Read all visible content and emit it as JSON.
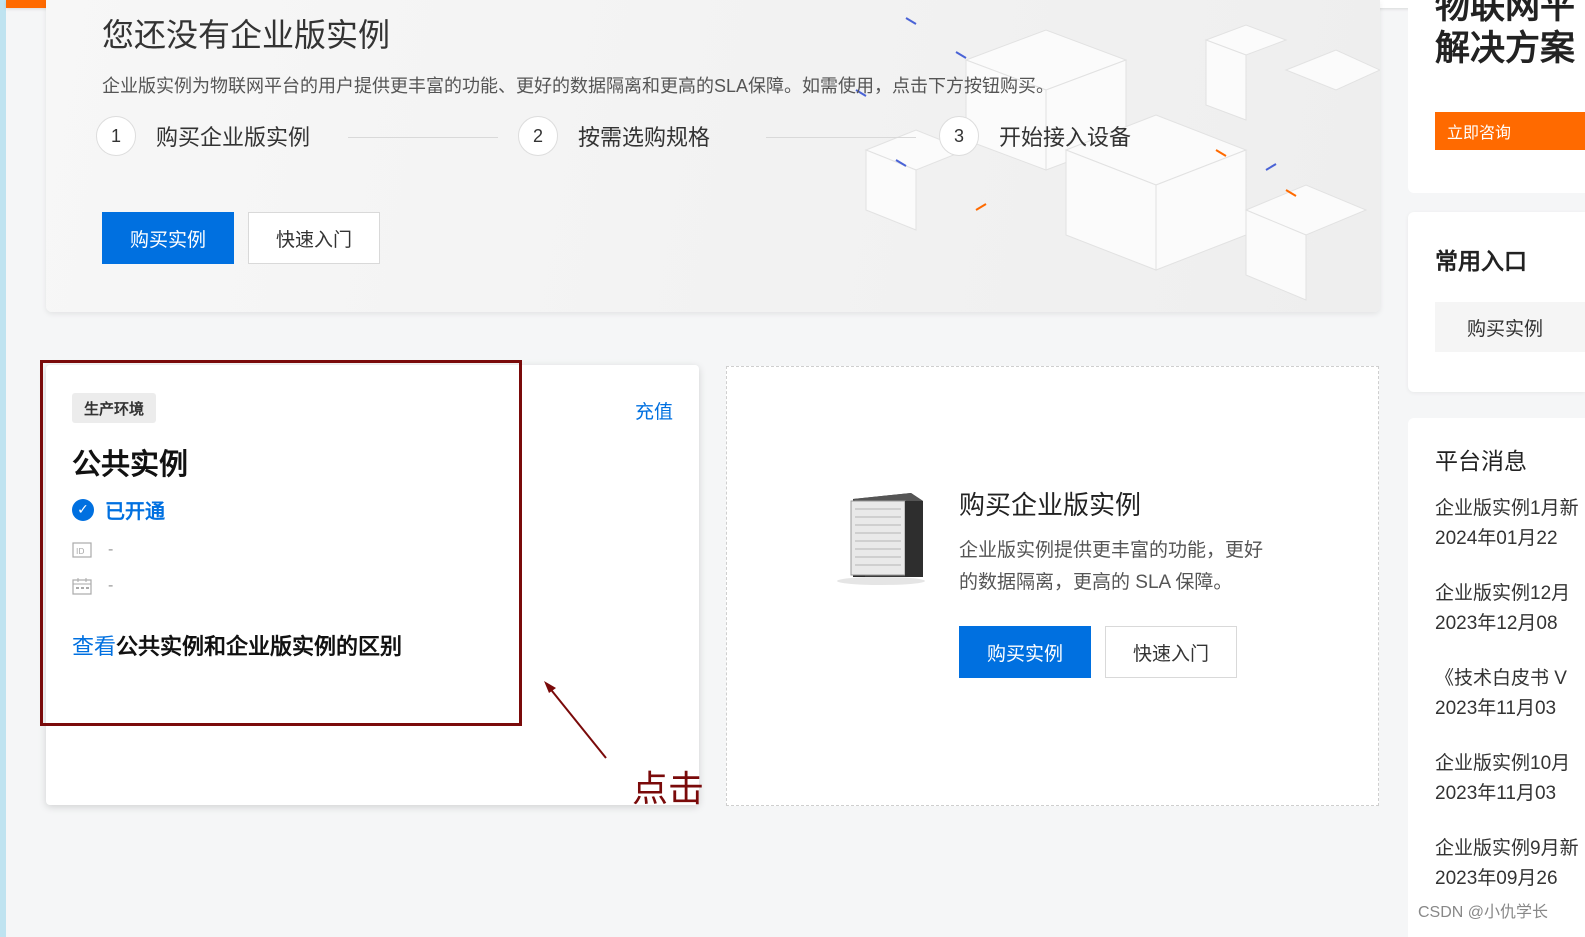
{
  "hero": {
    "title": "您还没有企业版实例",
    "description": "企业版实例为物联网平台的用户提供更丰富的功能、更好的数据隔离和更高的SLA保障。如需使用，点击下方按钮购买。",
    "steps": [
      {
        "num": "1",
        "label": "购买企业版实例"
      },
      {
        "num": "2",
        "label": "按需选购规格"
      },
      {
        "num": "3",
        "label": "开始接入设备"
      }
    ],
    "buy_label": "购买实例",
    "quickstart_label": "快速入门"
  },
  "public_instance": {
    "env_tag": "生产环境",
    "recharge": "充值",
    "title": "公共实例",
    "status": "已开通",
    "id_value": "-",
    "date_value": "-",
    "compare_link": "查看",
    "compare_text": "公共实例和企业版实例的区别"
  },
  "annotation": {
    "text": "点击"
  },
  "enterprise": {
    "title": "购买企业版实例",
    "description": "企业版实例提供更丰富的功能，更好的数据隔离，更高的 SLA 保障。",
    "buy_label": "购买实例",
    "quickstart_label": "快速入门"
  },
  "right_panel": {
    "promo_title_clipped": "物联网平",
    "promo_title": "解决方案",
    "consult_label": "立即咨询",
    "entry_title": "常用入口",
    "entry_button": "购买实例",
    "messages_title": "平台消息",
    "messages": [
      {
        "title": "企业版实例1月新",
        "date": "2024年01月22"
      },
      {
        "title": "企业版实例12月",
        "date": "2023年12月08"
      },
      {
        "title": "《技术白皮书 V",
        "date": "2023年11月03"
      },
      {
        "title": "企业版实例10月",
        "date": "2023年11月03"
      },
      {
        "title": "企业版实例9月新",
        "date": "2023年09月26"
      }
    ]
  },
  "watermark": "CSDN @小仇学长",
  "colors": {
    "primary": "#0070e0",
    "accent": "#ff6a00",
    "annotation": "#7a0a0a"
  }
}
